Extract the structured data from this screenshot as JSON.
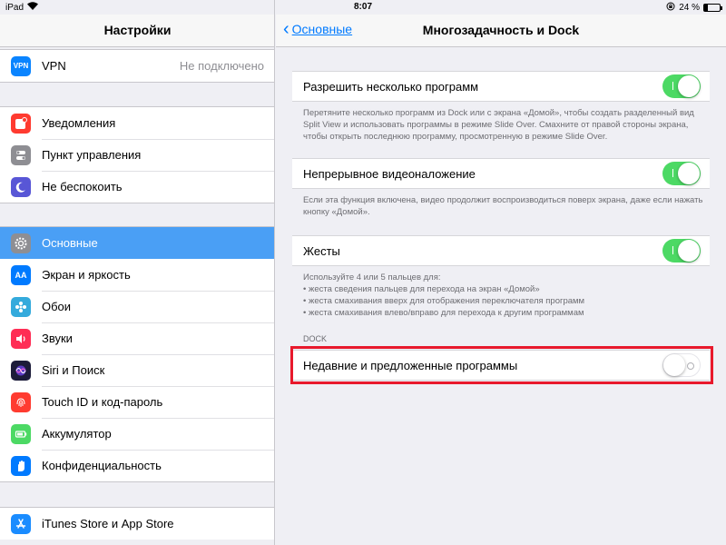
{
  "status_bar": {
    "device": "iPad",
    "time": "8:07",
    "battery": "24 %",
    "battery_level": 0.24
  },
  "sidebar": {
    "title": "Настройки",
    "groups": [
      {
        "items": [
          {
            "label": "VPN",
            "value": "Не подключено",
            "icon": "vpn-icon",
            "icon_text": "VPN",
            "color": "#0a84ff"
          }
        ]
      },
      {
        "items": [
          {
            "label": "Уведомления",
            "icon": "notifications-icon",
            "color": "#ff3b30"
          },
          {
            "label": "Пункт управления",
            "icon": "control-center-icon",
            "color": "#8e8e93"
          },
          {
            "label": "Не беспокоить",
            "icon": "moon-icon",
            "color": "#5856d6"
          }
        ]
      },
      {
        "items": [
          {
            "label": "Основные",
            "icon": "gear-icon",
            "color": "#8e8e93",
            "selected": true
          },
          {
            "label": "Экран и яркость",
            "icon": "display-icon",
            "icon_text": "AA",
            "color": "#007aff"
          },
          {
            "label": "Обои",
            "icon": "wallpaper-icon",
            "color": "#34aadc"
          },
          {
            "label": "Звуки",
            "icon": "speaker-icon",
            "color": "#ff2d55"
          },
          {
            "label": "Siri и Поиск",
            "icon": "siri-icon",
            "color": "#1c1c3a"
          },
          {
            "label": "Touch ID и код-пароль",
            "icon": "fingerprint-icon",
            "color": "#ff3b30"
          },
          {
            "label": "Аккумулятор",
            "icon": "battery-icon",
            "color": "#4cd964"
          },
          {
            "label": "Конфиденциальность",
            "icon": "hand-icon",
            "color": "#007aff"
          }
        ]
      },
      {
        "items": [
          {
            "label": "iTunes Store и App Store",
            "icon": "appstore-icon",
            "color": "#1a8cff"
          }
        ]
      }
    ]
  },
  "detail": {
    "back_label": "Основные",
    "title": "Многозадачность и Dock",
    "settings": [
      {
        "label": "Разрешить несколько программ",
        "on": true
      },
      {
        "label": "Непрерывное видеоналожение",
        "on": true
      },
      {
        "label": "Жесты",
        "on": true
      },
      {
        "label": "Недавние и предложенные программы",
        "on": false
      }
    ],
    "footnotes": [
      "Перетяните несколько программ из Dock или с экрана «Домой», чтобы создать разделенный вид Split View и использовать программы в режиме Slide Over. Смахните от правой стороны экрана, чтобы открыть последнюю программу, просмотренную в режиме Slide Over.",
      "Если эта функция включена, видео продолжит воспроизводиться поверх экрана, даже если нажать кнопку «Домой».",
      "Используйте 4 или 5 пальцев для:\n• жеста сведения пальцев для перехода на экран «Домой»\n• жеста смахивания вверх для отображения переключателя программ\n• жеста смахивания влево/вправо для перехода к другим программам"
    ],
    "dock_section": "DOCK"
  },
  "colors": {
    "accent": "#007aff",
    "toggle_on": "#4cd964",
    "highlight": "#e8192c",
    "selected_row": "#4a9ff5"
  }
}
